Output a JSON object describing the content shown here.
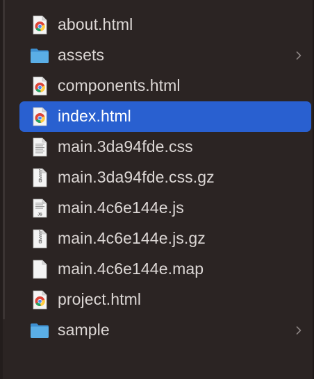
{
  "files": [
    {
      "name": "about.html",
      "type": "html",
      "icon": "chrome-html-icon",
      "folder": false,
      "selected": false
    },
    {
      "name": "assets",
      "type": "folder",
      "icon": "folder-icon",
      "folder": true,
      "selected": false
    },
    {
      "name": "components.html",
      "type": "html",
      "icon": "chrome-html-icon",
      "folder": false,
      "selected": false
    },
    {
      "name": "index.html",
      "type": "html",
      "icon": "chrome-html-icon",
      "folder": false,
      "selected": true
    },
    {
      "name": "main.3da94fde.css",
      "type": "css",
      "icon": "css-document-icon",
      "folder": false,
      "selected": false
    },
    {
      "name": "main.3da94fde.css.gz",
      "type": "gz",
      "icon": "archive-document-icon",
      "folder": false,
      "selected": false
    },
    {
      "name": "main.4c6e144e.js",
      "type": "js",
      "icon": "js-document-icon",
      "folder": false,
      "selected": false
    },
    {
      "name": "main.4c6e144e.js.gz",
      "type": "gz",
      "icon": "archive-document-icon",
      "folder": false,
      "selected": false
    },
    {
      "name": "main.4c6e144e.map",
      "type": "blank",
      "icon": "blank-document-icon",
      "folder": false,
      "selected": false
    },
    {
      "name": "project.html",
      "type": "html",
      "icon": "chrome-html-icon",
      "folder": false,
      "selected": false
    },
    {
      "name": "sample",
      "type": "folder",
      "icon": "folder-icon",
      "folder": true,
      "selected": false
    }
  ],
  "js_badge": "JS",
  "colors": {
    "background": "#2b2423",
    "selection": "#2960d0",
    "text": "#dcd7d5",
    "selected_text": "#ffffff",
    "folder": "#5aaee6"
  }
}
